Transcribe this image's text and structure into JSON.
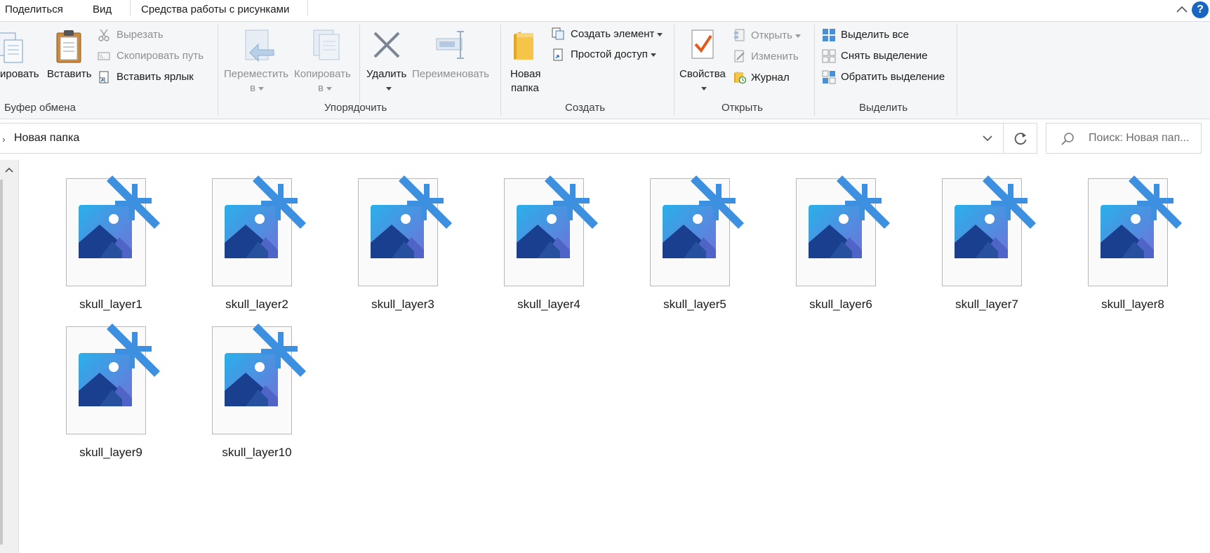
{
  "menu": {
    "tabs": [
      "Поделиться",
      "Вид",
      "Средства работы с рисунками"
    ],
    "help_label": "?"
  },
  "ribbon": {
    "clipboard": {
      "copy_label": "ировать",
      "paste_label": "Вставить",
      "cut_label": "Вырезать",
      "copy_path_label": "Скопировать путь",
      "paste_shortcut_label": "Вставить ярлык",
      "group_label": "Буфер обмена"
    },
    "organize": {
      "move_label": "Переместить",
      "move_sub": "в",
      "copy_label": "Копировать",
      "copy_sub": "в",
      "delete_label": "Удалить",
      "rename_label": "Переименовать",
      "group_label": "Упорядочить"
    },
    "new": {
      "new_folder_line1": "Новая",
      "new_folder_line2": "папка",
      "new_item_label": "Создать элемент",
      "easy_access_label": "Простой доступ",
      "group_label": "Создать"
    },
    "open": {
      "properties_label": "Свойства",
      "open_label": "Открыть",
      "edit_label": "Изменить",
      "history_label": "Журнал",
      "group_label": "Открыть"
    },
    "select": {
      "select_all_label": "Выделить все",
      "select_none_label": "Снять выделение",
      "invert_label": "Обратить выделение",
      "group_label": "Выделить"
    }
  },
  "address": {
    "path": "Новая папка",
    "search_placeholder": "Поиск: Новая пап..."
  },
  "files": [
    {
      "name": "skull_layer1"
    },
    {
      "name": "skull_layer2"
    },
    {
      "name": "skull_layer3"
    },
    {
      "name": "skull_layer4"
    },
    {
      "name": "skull_layer5"
    },
    {
      "name": "skull_layer6"
    },
    {
      "name": "skull_layer7"
    },
    {
      "name": "skull_layer8"
    },
    {
      "name": "skull_layer9"
    },
    {
      "name": "skull_layer10"
    }
  ],
  "colors": {
    "accent": "#1766c2",
    "compress_arrow": "#2f8be0",
    "photo_sky": "#29a3e3",
    "photo_mountain": "#1b3f8f"
  }
}
